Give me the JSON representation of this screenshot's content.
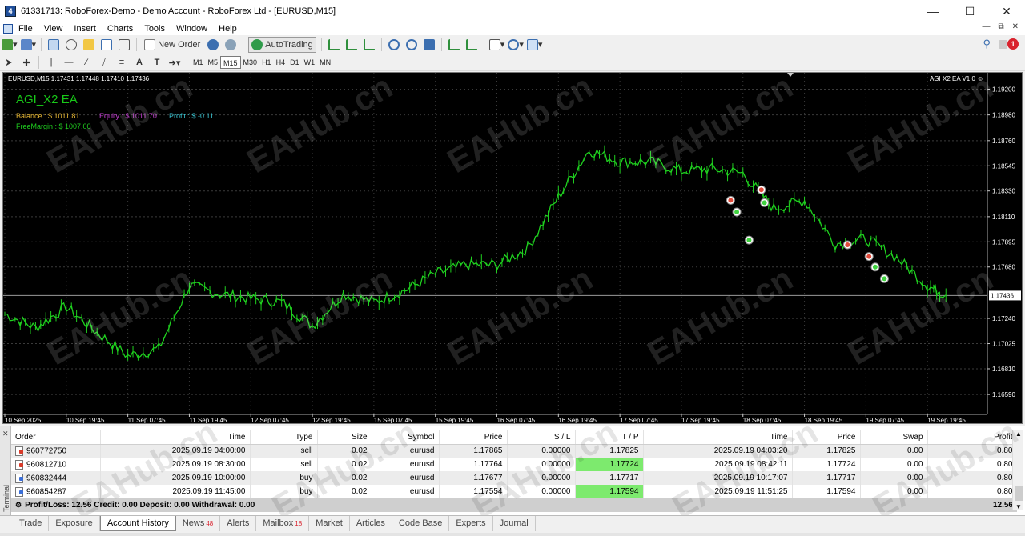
{
  "window": {
    "title": "61331713: RoboForex-Demo - Demo Account - RoboForex Ltd - [EURUSD,M15]",
    "app_icon": "mt4-icon"
  },
  "menu": {
    "items": [
      "File",
      "View",
      "Insert",
      "Charts",
      "Tools",
      "Window",
      "Help"
    ]
  },
  "toolbar": {
    "new_order_label": "New Order",
    "autotrading_label": "AutoTrading",
    "notification_count": "1"
  },
  "timeframes": [
    "M1",
    "M5",
    "M15",
    "M30",
    "H1",
    "H4",
    "D1",
    "W1",
    "MN"
  ],
  "active_timeframe": "M15",
  "chart": {
    "symbol_bar": "EURUSD,M15  1.17431 1.17448 1.17410 1.17436",
    "ea_tag": "AGI X2 EA V1.0 ☺",
    "ea_name": "AGI_X2 EA",
    "balance": "Balance : $ 1011.81",
    "equity": "Equity : $ 1011.70",
    "profit": "Profit : $ -0.11",
    "free_margin": "FreeMargin : $ 1007.00",
    "watermark": "EAHub.cn",
    "current_price_label": "1.17436",
    "colors": {
      "background": "#000000",
      "candles": "#1fd01f",
      "grid": "#3a3a3a",
      "price_line": "#9a9a9a"
    }
  },
  "chart_data": {
    "type": "line",
    "ylim": [
      1.1642,
      1.1934
    ],
    "y_ticks": [
      "1.19200",
      "1.18980",
      "1.18760",
      "1.18545",
      "1.18330",
      "1.18110",
      "1.17895",
      "1.17680",
      "1.17436",
      "1.17240",
      "1.17025",
      "1.16810",
      "1.16590"
    ],
    "x_ticks": [
      "10 Sep 2025",
      "10 Sep 19:45",
      "11 Sep 07:45",
      "11 Sep 19:45",
      "12 Sep 07:45",
      "12 Sep 19:45",
      "15 Sep 07:45",
      "15 Sep 19:45",
      "16 Sep 07:45",
      "16 Sep 19:45",
      "17 Sep 07:45",
      "17 Sep 19:45",
      "18 Sep 07:45",
      "18 Sep 19:45",
      "19 Sep 07:45",
      "19 Sep 19:45"
    ],
    "x": [
      0,
      0.5,
      1,
      1.5,
      2,
      2.5,
      3,
      3.5,
      4,
      4.5,
      5,
      5.5,
      6,
      6.5,
      7,
      7.5,
      8,
      8.5,
      9,
      9.5,
      10,
      10.5,
      11,
      11.5,
      12,
      12.5,
      13,
      13.5,
      14,
      14.5,
      15,
      15.3
    ],
    "series": [
      {
        "values": [
          1.1728,
          1.1716,
          1.1734,
          1.1712,
          1.1692,
          1.1698,
          1.1752,
          1.1745,
          1.1741,
          1.1738,
          1.1718,
          1.1745,
          1.1738,
          1.1748,
          1.1762,
          1.177,
          1.177,
          1.1784,
          1.1828,
          1.1868,
          1.1858,
          1.1858,
          1.185,
          1.1852,
          1.1848,
          1.1818,
          1.1825,
          1.1788,
          1.1792,
          1.1776,
          1.1752,
          1.1744
        ]
      }
    ],
    "trade_markers": [
      {
        "x": 11.8,
        "y": 1.1825,
        "kind": "sell-open"
      },
      {
        "x": 11.9,
        "y": 1.1815,
        "kind": "close"
      },
      {
        "x": 12.1,
        "y": 1.1791,
        "kind": "close"
      },
      {
        "x": 12.3,
        "y": 1.1834,
        "kind": "sell-open"
      },
      {
        "x": 12.35,
        "y": 1.1823,
        "kind": "close"
      },
      {
        "x": 13.7,
        "y": 1.1787,
        "kind": "buy-open"
      },
      {
        "x": 14.05,
        "y": 1.1777,
        "kind": "buy-open"
      },
      {
        "x": 14.15,
        "y": 1.1768,
        "kind": "close"
      },
      {
        "x": 14.3,
        "y": 1.1758,
        "kind": "close"
      }
    ]
  },
  "terminal": {
    "side_label": "Terminal",
    "columns": [
      "Order",
      "Time",
      "Type",
      "Size",
      "Symbol",
      "Price",
      "S / L",
      "T / P",
      "Time",
      "Price",
      "Swap",
      "Profit"
    ],
    "rows": [
      {
        "order": "960772750",
        "open_time": "2025.09.19 04:00:00",
        "type": "sell",
        "size": "0.02",
        "symbol": "eurusd",
        "price": "1.17865",
        "sl": "0.00000",
        "tp": "1.17825",
        "close_time": "2025.09.19 04:03:20",
        "close_price": "1.17825",
        "swap": "0.00",
        "profit": "0.80"
      },
      {
        "order": "960812710",
        "open_time": "2025.09.19 08:30:00",
        "type": "sell",
        "size": "0.02",
        "symbol": "eurusd",
        "price": "1.17764",
        "sl": "0.00000",
        "tp": "1.17724",
        "close_time": "2025.09.19 08:42:11",
        "close_price": "1.17724",
        "swap": "0.00",
        "profit": "0.80"
      },
      {
        "order": "960832444",
        "open_time": "2025.09.19 10:00:00",
        "type": "buy",
        "size": "0.02",
        "symbol": "eurusd",
        "price": "1.17677",
        "sl": "0.00000",
        "tp": "1.17717",
        "close_time": "2025.09.19 10:17:07",
        "close_price": "1.17717",
        "swap": "0.00",
        "profit": "0.80"
      },
      {
        "order": "960854287",
        "open_time": "2025.09.19 11:45:00",
        "type": "buy",
        "size": "0.02",
        "symbol": "eurusd",
        "price": "1.17554",
        "sl": "0.00000",
        "tp": "1.17594",
        "close_time": "2025.09.19 11:51:25",
        "close_price": "1.17594",
        "swap": "0.00",
        "profit": "0.80"
      }
    ],
    "summary": "Profit/Loss: 12.56  Credit: 0.00  Deposit: 0.00  Withdrawal: 0.00",
    "summary_total": "12.56"
  },
  "tabs": [
    {
      "label": "Trade",
      "count": ""
    },
    {
      "label": "Exposure",
      "count": ""
    },
    {
      "label": "Account History",
      "count": "",
      "active": true
    },
    {
      "label": "News",
      "count": "48"
    },
    {
      "label": "Alerts",
      "count": ""
    },
    {
      "label": "Mailbox",
      "count": "18"
    },
    {
      "label": "Market",
      "count": ""
    },
    {
      "label": "Articles",
      "count": ""
    },
    {
      "label": "Code Base",
      "count": ""
    },
    {
      "label": "Experts",
      "count": ""
    },
    {
      "label": "Journal",
      "count": ""
    }
  ]
}
